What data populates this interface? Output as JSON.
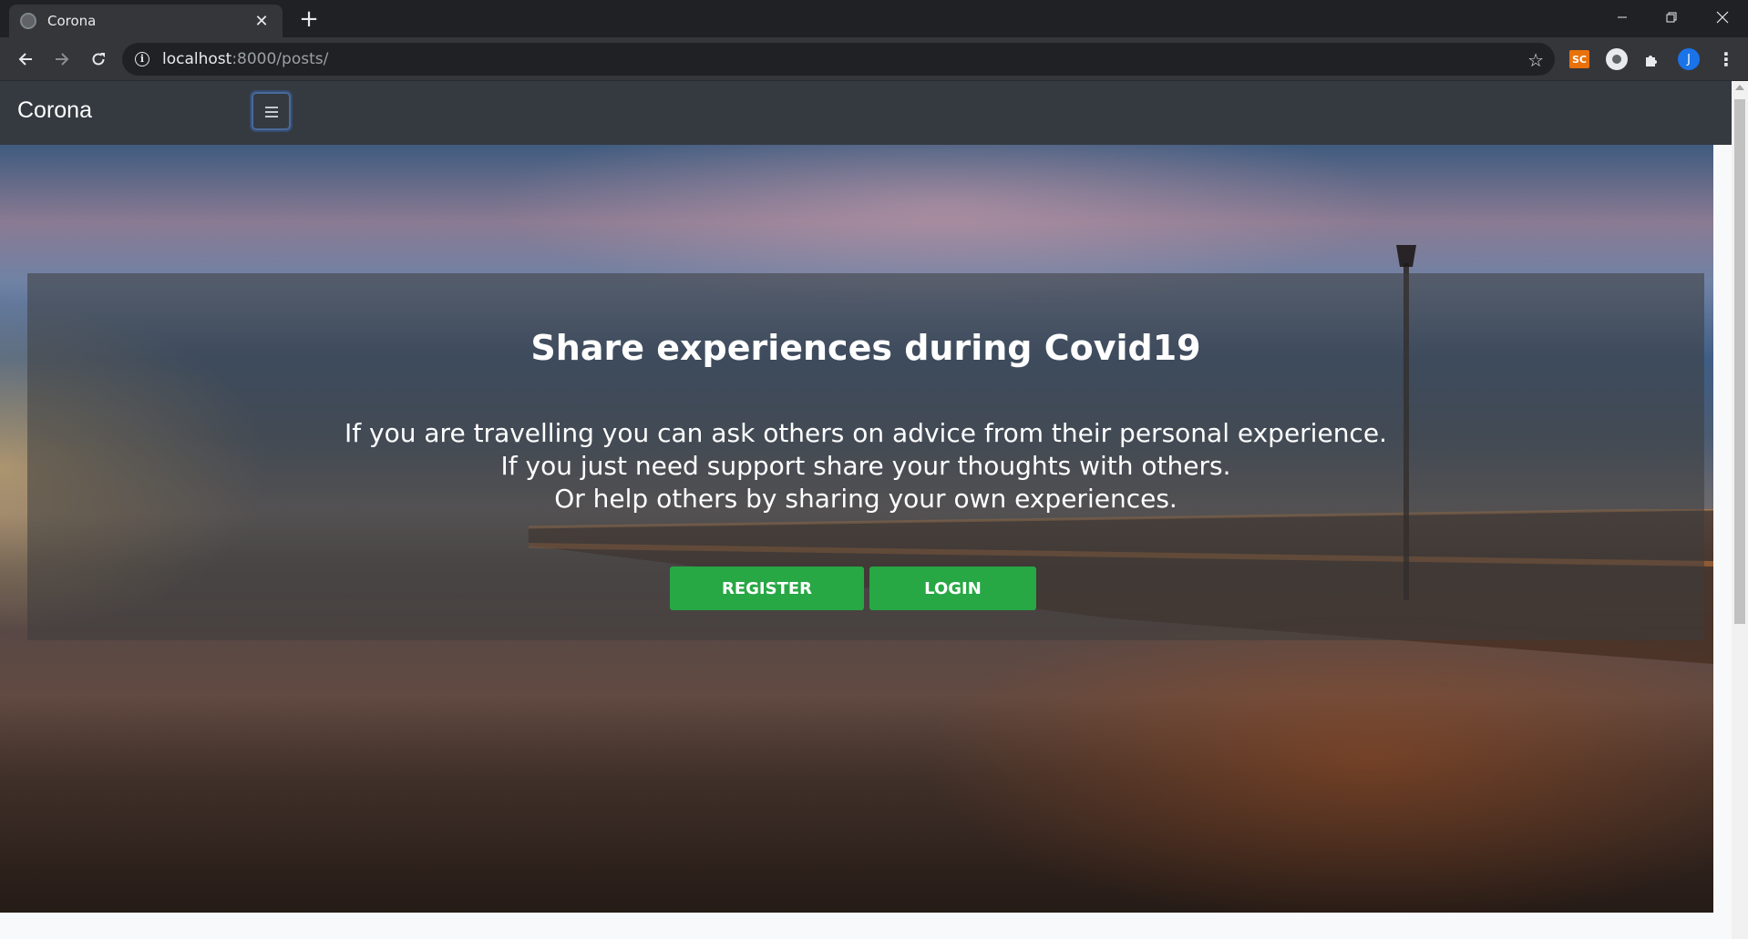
{
  "browser": {
    "tab_title": "Corona",
    "tab_close": "✕",
    "new_tab": "+",
    "url_host": "localhost",
    "url_rest": ":8000/posts/",
    "extension_sc": "SC",
    "profile_initial": "J",
    "icons": [
      "back-arrow-icon",
      "forward-arrow-icon",
      "reload-icon",
      "info-icon",
      "star-icon",
      "extensions-icon",
      "menu-icon",
      "minimize-icon",
      "restore-icon",
      "close-icon"
    ]
  },
  "navbar": {
    "brand": "Corona",
    "toggler_icon": "hamburger-icon"
  },
  "hero": {
    "title": "Share experiences during Covid19",
    "lines": [
      "If you are travelling you can ask others on advice from their personal experience.",
      "If you just need support share your thoughts with others.",
      "Or help others by sharing your own experiences."
    ],
    "register_label": "REGISTER",
    "login_label": "LOGIN"
  },
  "colors": {
    "navbar_bg": "#343a40",
    "button_green": "#28a745",
    "browser_frame": "#202124",
    "toolbar": "#35363a"
  }
}
